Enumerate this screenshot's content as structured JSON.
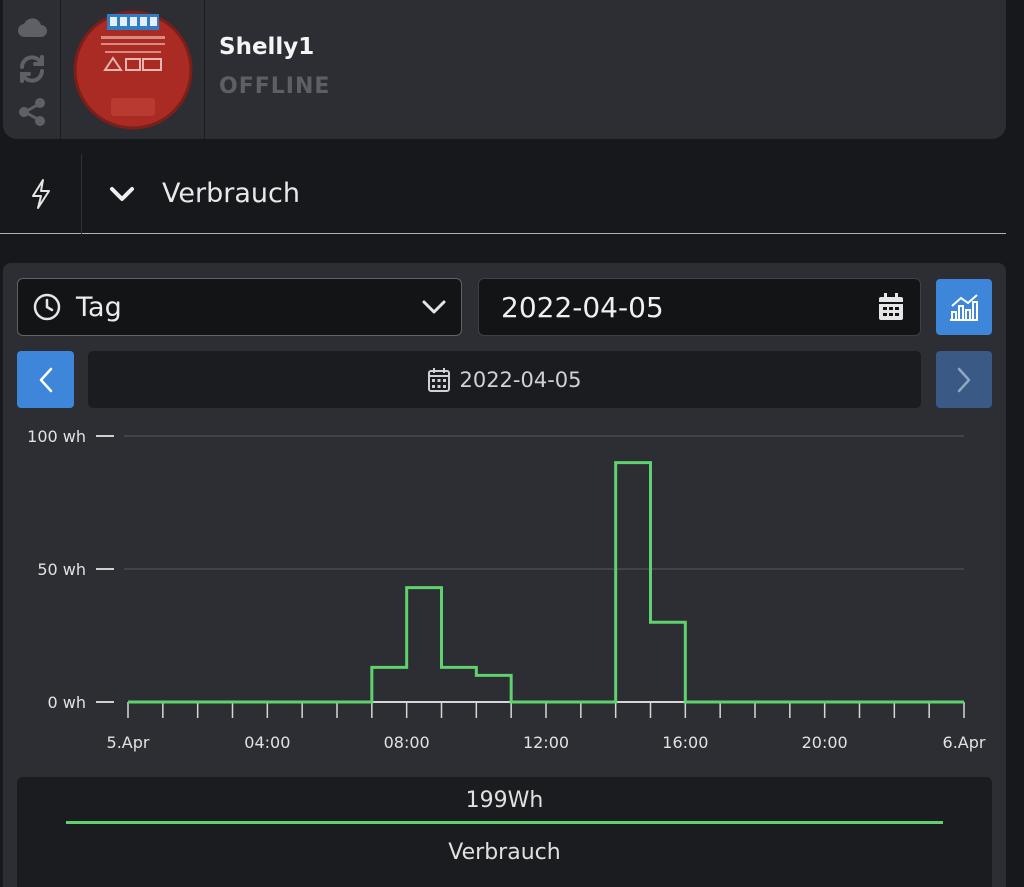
{
  "device": {
    "name": "Shelly1",
    "status": "OFFLINE",
    "actions": [
      "cloud-icon",
      "sync-icon",
      "share-icon"
    ]
  },
  "section": {
    "title": "Verbrauch",
    "icon": "lightning-icon"
  },
  "controls": {
    "period": "Tag",
    "date_value": "2022-04-05",
    "date_bar_label": "2022-04-05"
  },
  "colors": {
    "series": "#5fd16e",
    "accent": "#3e86da",
    "accent_dim": "#3a5a85"
  },
  "chart_data": {
    "type": "line",
    "step": true,
    "x_tick_labels": [
      "5.Apr",
      "04:00",
      "08:00",
      "12:00",
      "16:00",
      "20:00",
      "6.Apr"
    ],
    "y_tick_labels": [
      "100 wh",
      "50 wh",
      "0 wh"
    ],
    "ylim": [
      0,
      100
    ],
    "xlim": [
      0,
      24
    ],
    "grid": true,
    "series": [
      {
        "hours": [
          "00:00",
          "01:00",
          "02:00",
          "03:00",
          "04:00",
          "05:00",
          "06:00",
          "07:00",
          "08:00",
          "09:00",
          "10:00",
          "11:00",
          "12:00",
          "13:00",
          "14:00",
          "15:00",
          "16:00",
          "17:00",
          "18:00",
          "19:00",
          "20:00",
          "21:00",
          "22:00",
          "23:00"
        ],
        "values": [
          0,
          0,
          0,
          0,
          0,
          0,
          0,
          13,
          43,
          13,
          10,
          0,
          0,
          0,
          90,
          30,
          0,
          0,
          0,
          0,
          0,
          0,
          0,
          0
        ]
      }
    ]
  },
  "legend": {
    "total": "199Wh",
    "series_name": "Verbrauch"
  }
}
